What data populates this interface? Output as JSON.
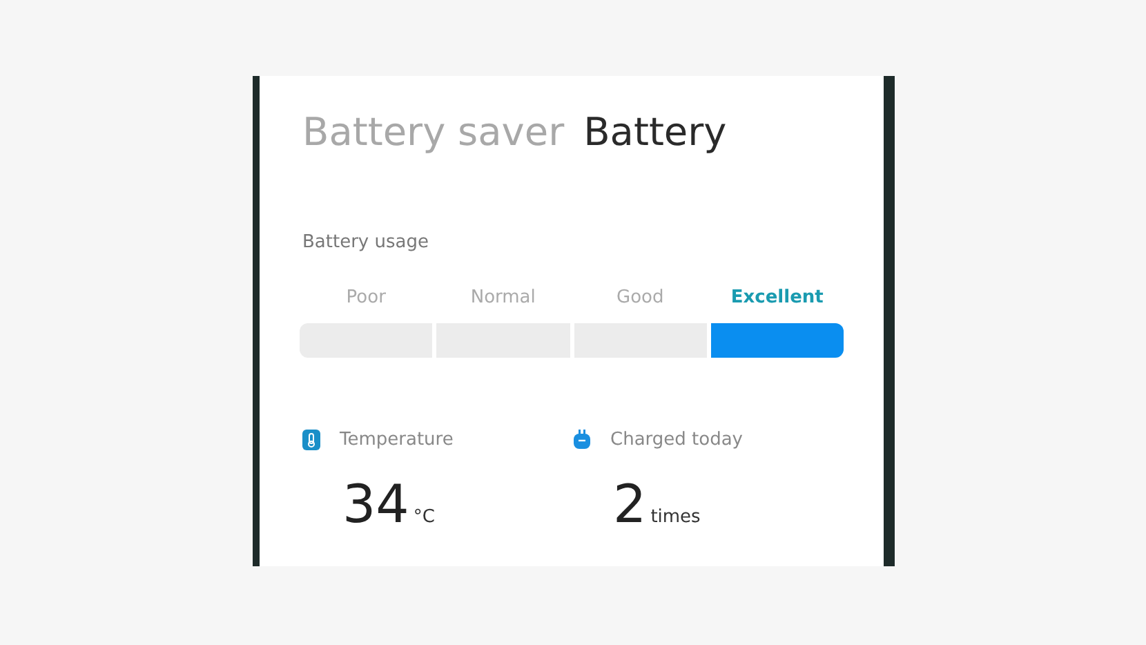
{
  "tabs": [
    {
      "label": "Battery saver",
      "selected": false
    },
    {
      "label": "Battery",
      "selected": true
    }
  ],
  "usage": {
    "title": "Battery usage",
    "levels": [
      {
        "label": "Poor",
        "selected": false
      },
      {
        "label": "Normal",
        "selected": false
      },
      {
        "label": "Good",
        "selected": false
      },
      {
        "label": "Excellent",
        "selected": true
      }
    ]
  },
  "stats": [
    {
      "kind": "temperature",
      "label": "Temperature",
      "value": "34",
      "unit": "°C"
    },
    {
      "kind": "charge",
      "label": "Charged today",
      "value": "2",
      "unit": "times"
    }
  ]
}
